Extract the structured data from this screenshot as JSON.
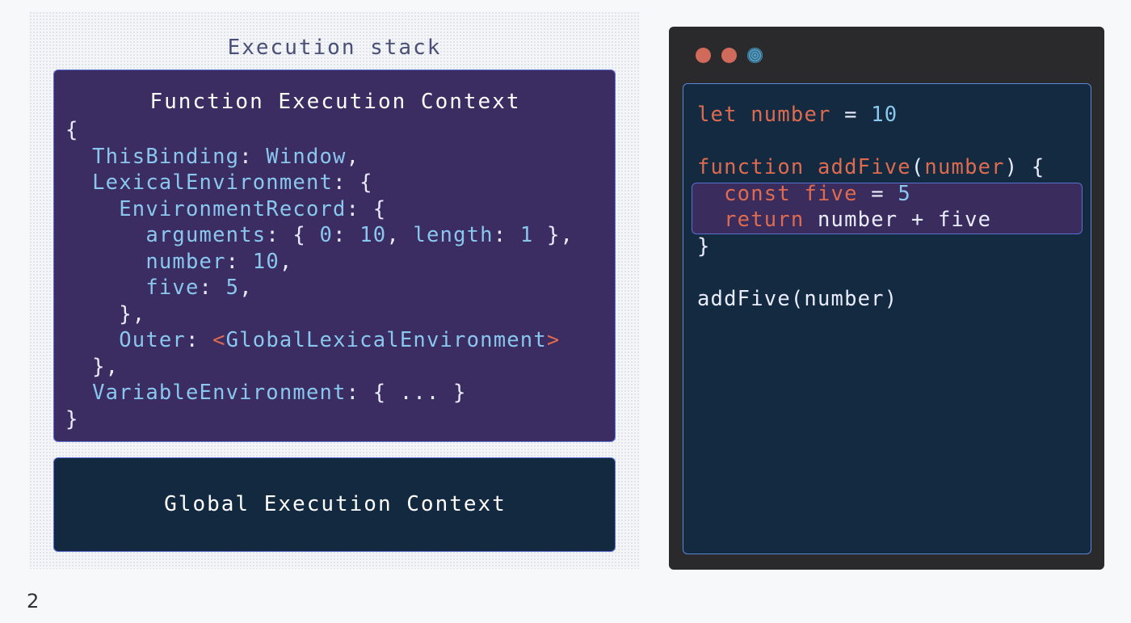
{
  "stack": {
    "title": "Execution stack",
    "function_context": {
      "title": "Function Execution Context",
      "lines": [
        [
          {
            "t": "{",
            "c": "plain"
          }
        ],
        [
          {
            "t": "  ",
            "c": "plain"
          },
          {
            "t": "ThisBinding",
            "c": "prop"
          },
          {
            "t": ": ",
            "c": "plain"
          },
          {
            "t": "Window",
            "c": "prop"
          },
          {
            "t": ",",
            "c": "plain"
          }
        ],
        [
          {
            "t": "  ",
            "c": "plain"
          },
          {
            "t": "LexicalEnvironment",
            "c": "prop"
          },
          {
            "t": ": {",
            "c": "plain"
          }
        ],
        [
          {
            "t": "    ",
            "c": "plain"
          },
          {
            "t": "EnvironmentRecord",
            "c": "prop"
          },
          {
            "t": ": {",
            "c": "plain"
          }
        ],
        [
          {
            "t": "      ",
            "c": "plain"
          },
          {
            "t": "arguments",
            "c": "prop"
          },
          {
            "t": ": { ",
            "c": "plain"
          },
          {
            "t": "0",
            "c": "num"
          },
          {
            "t": ": ",
            "c": "plain"
          },
          {
            "t": "10",
            "c": "num"
          },
          {
            "t": ", ",
            "c": "plain"
          },
          {
            "t": "length",
            "c": "prop"
          },
          {
            "t": ": ",
            "c": "plain"
          },
          {
            "t": "1",
            "c": "num"
          },
          {
            "t": " },",
            "c": "plain"
          }
        ],
        [
          {
            "t": "      ",
            "c": "plain"
          },
          {
            "t": "number",
            "c": "prop"
          },
          {
            "t": ": ",
            "c": "plain"
          },
          {
            "t": "10",
            "c": "num"
          },
          {
            "t": ",",
            "c": "plain"
          }
        ],
        [
          {
            "t": "      ",
            "c": "plain"
          },
          {
            "t": "five",
            "c": "prop"
          },
          {
            "t": ": ",
            "c": "plain"
          },
          {
            "t": "5",
            "c": "num"
          },
          {
            "t": ",",
            "c": "plain"
          }
        ],
        [
          {
            "t": "    },",
            "c": "plain"
          }
        ],
        [
          {
            "t": "    ",
            "c": "plain"
          },
          {
            "t": "Outer",
            "c": "prop"
          },
          {
            "t": ": ",
            "c": "plain"
          },
          {
            "t": "<",
            "c": "ref"
          },
          {
            "t": "GlobalLexicalEnvironment",
            "c": "prop"
          },
          {
            "t": ">",
            "c": "ref"
          }
        ],
        [
          {
            "t": "  },",
            "c": "plain"
          }
        ],
        [
          {
            "t": "  ",
            "c": "plain"
          },
          {
            "t": "VariableEnvironment",
            "c": "prop"
          },
          {
            "t": ": { ... }",
            "c": "plain"
          }
        ],
        [
          {
            "t": "}",
            "c": "plain"
          }
        ]
      ]
    },
    "global_context": {
      "title": "Global Execution Context"
    }
  },
  "editor": {
    "window_dots": [
      "close-dot",
      "minimize-dot",
      "maximize-dot"
    ],
    "code_lines": [
      [
        {
          "t": "let",
          "c": "kw"
        },
        {
          "t": " ",
          "c": "plain"
        },
        {
          "t": "number",
          "c": "var"
        },
        {
          "t": " = ",
          "c": "plain"
        },
        {
          "t": "10",
          "c": "num"
        }
      ],
      [],
      [
        {
          "t": "function",
          "c": "kw"
        },
        {
          "t": " ",
          "c": "plain"
        },
        {
          "t": "addFive",
          "c": "var"
        },
        {
          "t": "(",
          "c": "plain"
        },
        {
          "t": "number",
          "c": "var"
        },
        {
          "t": ") {",
          "c": "plain"
        }
      ],
      [
        {
          "t": "  ",
          "c": "plain"
        },
        {
          "t": "const",
          "c": "kw"
        },
        {
          "t": " ",
          "c": "plain"
        },
        {
          "t": "five",
          "c": "var"
        },
        {
          "t": " = ",
          "c": "plain"
        },
        {
          "t": "5",
          "c": "num"
        }
      ],
      [
        {
          "t": "  ",
          "c": "plain"
        },
        {
          "t": "return",
          "c": "kw"
        },
        {
          "t": " number + five",
          "c": "plain"
        }
      ],
      [
        {
          "t": "}",
          "c": "plain"
        }
      ],
      [],
      [
        {
          "t": "addFive(number)",
          "c": "plain"
        }
      ]
    ],
    "highlighted_lines": [
      3,
      4
    ]
  },
  "slide_number": "2",
  "colors": {
    "keyword": "#de6b50",
    "property": "#8ac7ee",
    "plain": "#e9ecff",
    "function_context_bg": "#3b2c62",
    "global_context_bg": "#13293f",
    "editor_bg": "#2a2a2c"
  }
}
